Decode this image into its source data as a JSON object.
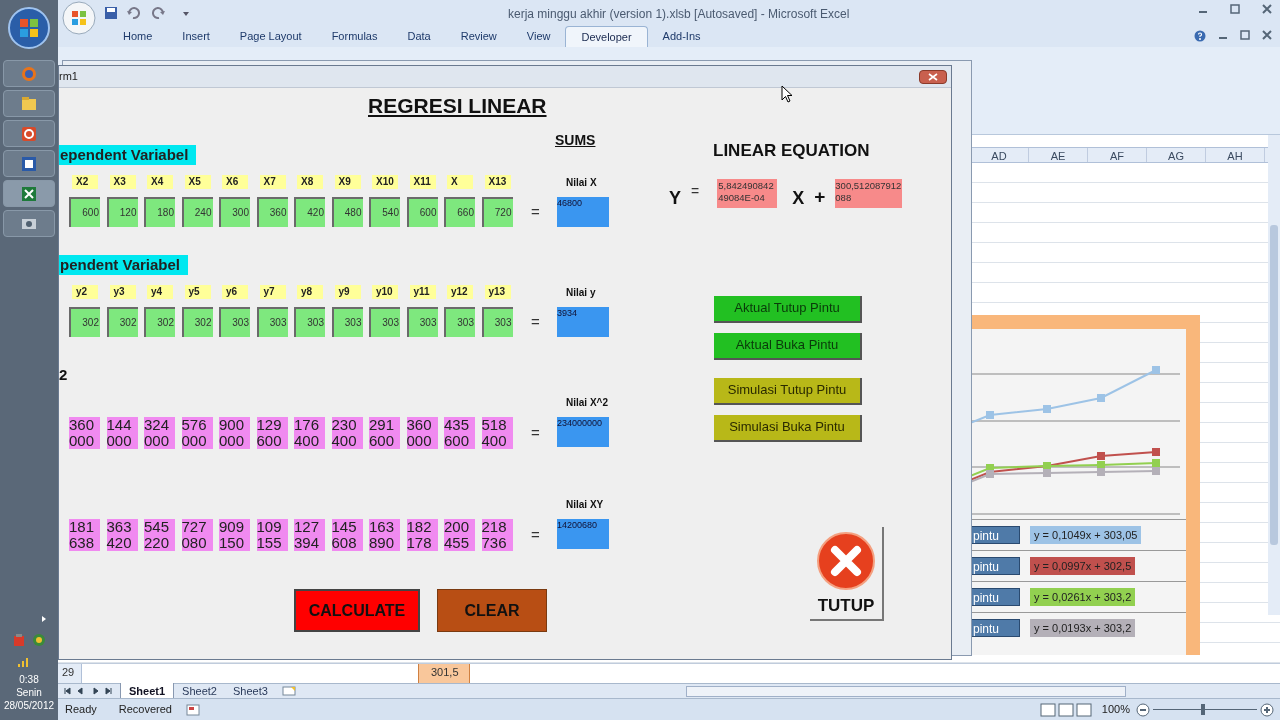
{
  "excel": {
    "title": "kerja minggu akhir (version 1).xlsb [Autosaved] - Microsoft Excel",
    "tabs": [
      {
        "label": "Home",
        "selected": false
      },
      {
        "label": "Insert",
        "selected": false
      },
      {
        "label": "Page Layout",
        "selected": false
      },
      {
        "label": "Formulas",
        "selected": false
      },
      {
        "label": "Data",
        "selected": false
      },
      {
        "label": "Review",
        "selected": false
      },
      {
        "label": "View",
        "selected": false
      },
      {
        "label": "Developer",
        "selected": true
      },
      {
        "label": "Add-Ins",
        "selected": false
      }
    ],
    "columns": [
      "AD",
      "AE",
      "AF",
      "AG",
      "AH"
    ],
    "legend": [
      {
        "label": "pintu",
        "equation": "y = 0,1049x + 303,05",
        "color": "#9dc3e6"
      },
      {
        "label": "pintu",
        "equation": "y = 0,0997x + 302,5",
        "color": "#c0504d"
      },
      {
        "label": "pintu",
        "equation": "y = 0,0261x + 303,2",
        "color": "#92d050"
      },
      {
        "label": "pintu",
        "equation": "y = 0,0193x + 303,2",
        "color": "#b4b0b8"
      }
    ],
    "row_header": "29",
    "cell": "301,5",
    "sheets": [
      {
        "label": "Sheet1",
        "selected": true
      },
      {
        "label": "Sheet2",
        "selected": false
      },
      {
        "label": "Sheet3",
        "selected": false
      }
    ],
    "status": {
      "mode": "Ready",
      "recovered": "Recovered",
      "zoom": "100%",
      "zoom_slider": {
        "level": 0.5
      }
    }
  },
  "taskbar": {
    "time": "0:38",
    "day": "Senin",
    "date": "28/05/2012"
  },
  "form": {
    "title": "rm1",
    "heading": "REGRESI LINEAR",
    "sums_heading": "SUMS",
    "rows": [
      {
        "kind": "input",
        "section": "ependent Variabel",
        "labels": [
          "X2",
          "X3",
          "X4",
          "X5",
          "X6",
          "X7",
          "X8",
          "X9",
          "X10",
          "X11",
          "X",
          "X13"
        ],
        "values": [
          "600",
          "120",
          "180",
          "240",
          "300",
          "360",
          "420",
          "480",
          "540",
          "600",
          "660",
          "720"
        ],
        "equals": "=",
        "sum_label": "Nilai X",
        "sum": "46800"
      },
      {
        "kind": "input",
        "section": "pendent Variabel",
        "labels": [
          "y2",
          "y3",
          "y4",
          "y5",
          "y6",
          "y7",
          "y8",
          "y9",
          "y10",
          "y11",
          "y12",
          "y13"
        ],
        "values": [
          "302",
          "302",
          "302",
          "302",
          "303",
          "303",
          "303",
          "303",
          "303",
          "303",
          "303",
          "303"
        ],
        "equals": "=",
        "sum_label": "Nilai y",
        "sum": "3934"
      },
      {
        "kind": "product",
        "section": "2",
        "values": [
          "360000",
          "144000",
          "324000",
          "576000",
          "900000",
          "129600",
          "176400",
          "230400",
          "291600",
          "360000",
          "435600",
          "518400"
        ],
        "equals": "=",
        "sum_label": "Nilai X^2",
        "sum": "234000000"
      },
      {
        "kind": "product",
        "values": [
          "181638",
          "363420",
          "545220",
          "727080",
          "909150",
          "109155",
          "127394",
          "145608",
          "163890",
          "182178",
          "200455",
          "218736"
        ],
        "equals": "=",
        "sum_label": "Nilai XY",
        "sum": "14200680"
      }
    ],
    "equation": {
      "heading": "LINEAR EQUATION",
      "y": "Y",
      "eq": "=",
      "slope": "5,84249084249084E-04",
      "x": "X",
      "plus": "+",
      "intercept": "300,512087912088"
    },
    "chart_buttons": [
      {
        "label": "Aktual Tutup Pintu",
        "kind": "aktual"
      },
      {
        "label": "Aktual Buka Pintu",
        "kind": "aktual"
      },
      {
        "label": "Simulasi Tutup Pintu",
        "kind": "simulasi"
      },
      {
        "label": "Simulasi Buka Pintu",
        "kind": "simulasi"
      }
    ],
    "calculate": "CALCULATE",
    "clear": "CLEAR",
    "close": "TUTUP"
  }
}
